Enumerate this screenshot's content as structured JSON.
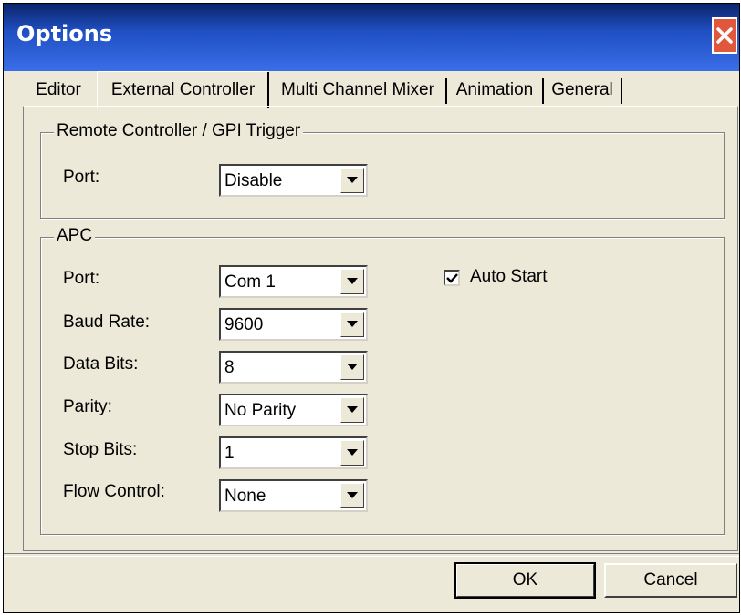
{
  "window": {
    "title": "Options",
    "close_icon": "close-icon",
    "titlebar_color": "#1f4fc1",
    "close_color": "#e1573c"
  },
  "tabs": [
    {
      "label": "Editor",
      "active": false
    },
    {
      "label": "External Controller",
      "active": true
    },
    {
      "label": "Multi Channel Mixer",
      "active": false
    },
    {
      "label": "Animation",
      "active": false
    },
    {
      "label": "General",
      "active": false
    }
  ],
  "remote_group": {
    "legend": "Remote Controller / GPI Trigger",
    "port_label": "Port:",
    "port_value": "Disable"
  },
  "apc_group": {
    "legend": "APC",
    "fields": [
      {
        "label": "Port:",
        "value": "Com 1"
      },
      {
        "label": "Baud Rate:",
        "value": "9600"
      },
      {
        "label": "Data Bits:",
        "value": "8"
      },
      {
        "label": "Parity:",
        "value": "No Parity"
      },
      {
        "label": "Stop Bits:",
        "value": "1"
      },
      {
        "label": "Flow Control:",
        "value": "None"
      }
    ],
    "auto_start_label": "Auto Start",
    "auto_start_checked": true
  },
  "buttons": {
    "ok": "OK",
    "cancel": "Cancel"
  }
}
